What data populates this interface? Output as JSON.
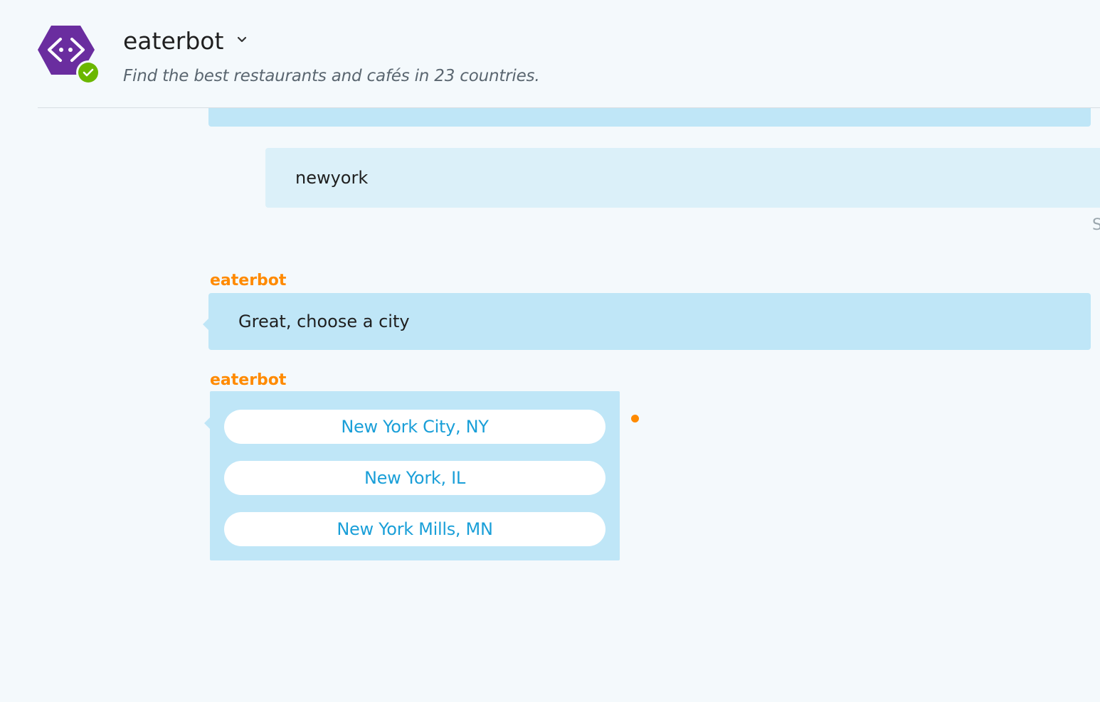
{
  "header": {
    "bot_name": "eaterbot",
    "description": "Find the best restaurants and cafés in 23 countries.",
    "avatar_icon": "code-brackets-icon",
    "online_badge_icon": "checkmark-icon",
    "menu_icon": "chevron-down-icon",
    "colors": {
      "avatar": "#6a2d9f",
      "online_badge": "#6bb700"
    }
  },
  "messages": {
    "user_message": "newyork",
    "user_status_cutoff": "S",
    "bot_sender": "eaterbot",
    "bot_text": "Great, choose a city",
    "choices_sender": "eaterbot",
    "choices": [
      "New York City, NY",
      "New York, IL",
      "New York Mills, MN"
    ]
  },
  "colors": {
    "sender_name": "#ff8a00",
    "bot_bubble": "#bfe6f7",
    "user_bubble": "#dbf0f9",
    "choice_text": "#1a9fd8",
    "status_dot": "#ff8a00"
  }
}
